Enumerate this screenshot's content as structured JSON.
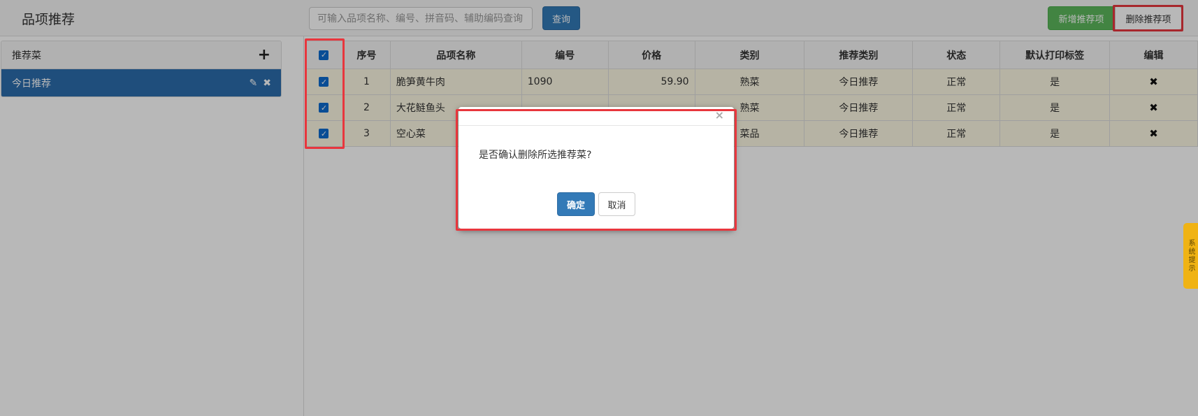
{
  "header": {
    "title": "品项推荐",
    "search_placeholder": "可输入品项名称、编号、拼音码、辅助编码查询",
    "query_label": "查询",
    "add_label": "新增推荐项",
    "delete_label": "删除推荐项"
  },
  "sidebar": {
    "title": "推荐菜",
    "add_icon": "plus-icon",
    "items": [
      {
        "label": "今日推荐",
        "icons": [
          "edit-icon",
          "delete-icon"
        ]
      }
    ]
  },
  "table": {
    "columns": [
      "序号",
      "品项名称",
      "编号",
      "价格",
      "类别",
      "推荐类别",
      "状态",
      "默认打印标签",
      "编辑"
    ],
    "rows": [
      {
        "checked": true,
        "seq": "1",
        "name": "脆笋黄牛肉",
        "code": "1090",
        "price": "59.90",
        "category": "熟菜",
        "rec_type": "今日推荐",
        "status": "正常",
        "default_label": "是"
      },
      {
        "checked": true,
        "seq": "2",
        "name": "大花鲢鱼头",
        "code": "",
        "price": "",
        "category": "熟菜",
        "rec_type": "今日推荐",
        "status": "正常",
        "default_label": "是"
      },
      {
        "checked": true,
        "seq": "3",
        "name": "空心菜",
        "code": "",
        "price": "",
        "category": "菜品",
        "rec_type": "今日推荐",
        "status": "正常",
        "default_label": "是"
      }
    ]
  },
  "modal": {
    "message": "是否确认删除所选推荐菜?",
    "ok_label": "确定",
    "cancel_label": "取消"
  },
  "side_tab": {
    "label": "系统提示"
  },
  "colors": {
    "primary": "#337ab7",
    "success": "#5cb85c",
    "selected_row": "#fcf8e3",
    "active_item": "#2c6dac",
    "highlight": "#e8363d",
    "side_tab": "#f0b314"
  }
}
